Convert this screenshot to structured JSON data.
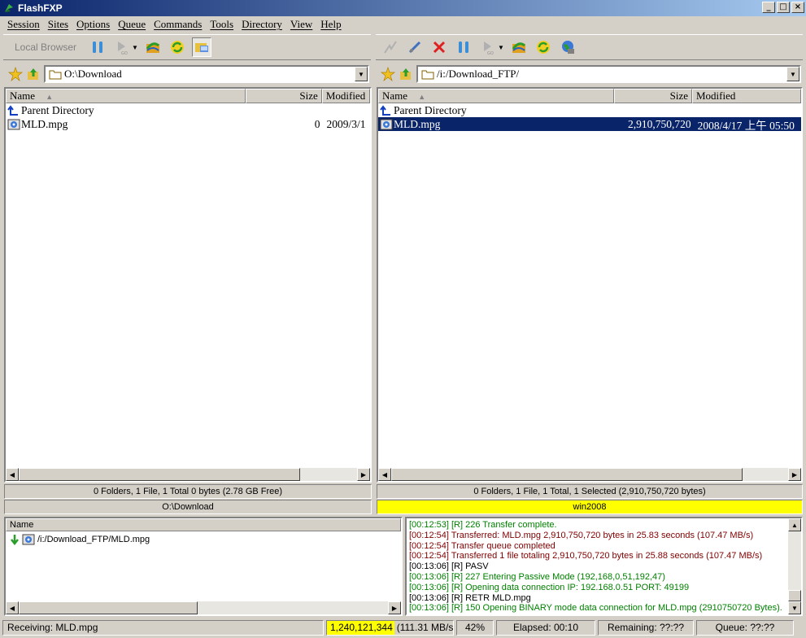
{
  "window": {
    "title": "FlashFXP"
  },
  "menu": [
    "Session",
    "Sites",
    "Options",
    "Queue",
    "Commands",
    "Tools",
    "Directory",
    "View",
    "Help"
  ],
  "left_toolbar": {
    "local_browser_label": "Local Browser"
  },
  "left": {
    "path": "O:\\Download",
    "columns": {
      "name": "Name",
      "size": "Size",
      "modified": "Modified"
    },
    "rows": [
      {
        "name": "Parent Directory",
        "size": "",
        "modified": ""
      },
      {
        "name": "MLD.mpg",
        "size": "0",
        "modified": "2009/3/1"
      }
    ],
    "summary": "0 Folders, 1 File, 1 Total 0 bytes (2.78 GB Free)",
    "location": "O:\\Download"
  },
  "right": {
    "path": "/i:/Download_FTP/",
    "columns": {
      "name": "Name",
      "size": "Size",
      "modified": "Modified"
    },
    "rows": [
      {
        "name": "Parent Directory",
        "size": "",
        "modified": ""
      },
      {
        "name": "MLD.mpg",
        "size": "2,910,750,720",
        "modified": "2008/4/17 上午 05:50"
      }
    ],
    "summary": "0 Folders, 1 File, 1 Total, 1 Selected (2,910,750,720 bytes)",
    "location": "win2008"
  },
  "queue": {
    "column": "Name",
    "items": [
      "/i:/Download_FTP/MLD.mpg"
    ]
  },
  "log": [
    {
      "text": "[00:12:53] [R] 226 Transfer complete.",
      "color": "#008000"
    },
    {
      "text": "[00:12:54] Transferred: MLD.mpg 2,910,750,720 bytes in 25.83 seconds (107.47 MB/s)",
      "color": "#800000"
    },
    {
      "text": "[00:12:54] Transfer queue completed",
      "color": "#800000"
    },
    {
      "text": "[00:12:54] Transferred 1 file totaling 2,910,750,720 bytes in 25.88 seconds (107.47 MB/s)",
      "color": "#800000"
    },
    {
      "text": "[00:13:06] [R] PASV",
      "color": "#000000"
    },
    {
      "text": "[00:13:06] [R] 227 Entering Passive Mode (192,168,0,51,192,47)",
      "color": "#008000"
    },
    {
      "text": "[00:13:06] [R] Opening data connection IP: 192.168.0.51 PORT: 49199",
      "color": "#008000"
    },
    {
      "text": "[00:13:06] [R] RETR MLD.mpg",
      "color": "#000000"
    },
    {
      "text": "[00:13:06] [R] 150 Opening BINARY mode data connection for MLD.mpg (2910750720 Bytes).",
      "color": "#008000"
    }
  ],
  "status": {
    "receiving": "Receiving: MLD.mpg",
    "bytes": "1,240,121,344",
    "speed": "(111.31 MB/s)",
    "percent": "42%",
    "elapsed": "Elapsed: 00:10",
    "remaining": "Remaining: ??:??",
    "queue": "Queue: ??:??"
  },
  "colors": {
    "title_start": "#0a246a",
    "title_end": "#a6caf0",
    "selected": "#0a246a",
    "highlight_yellow": "#ffff00"
  }
}
